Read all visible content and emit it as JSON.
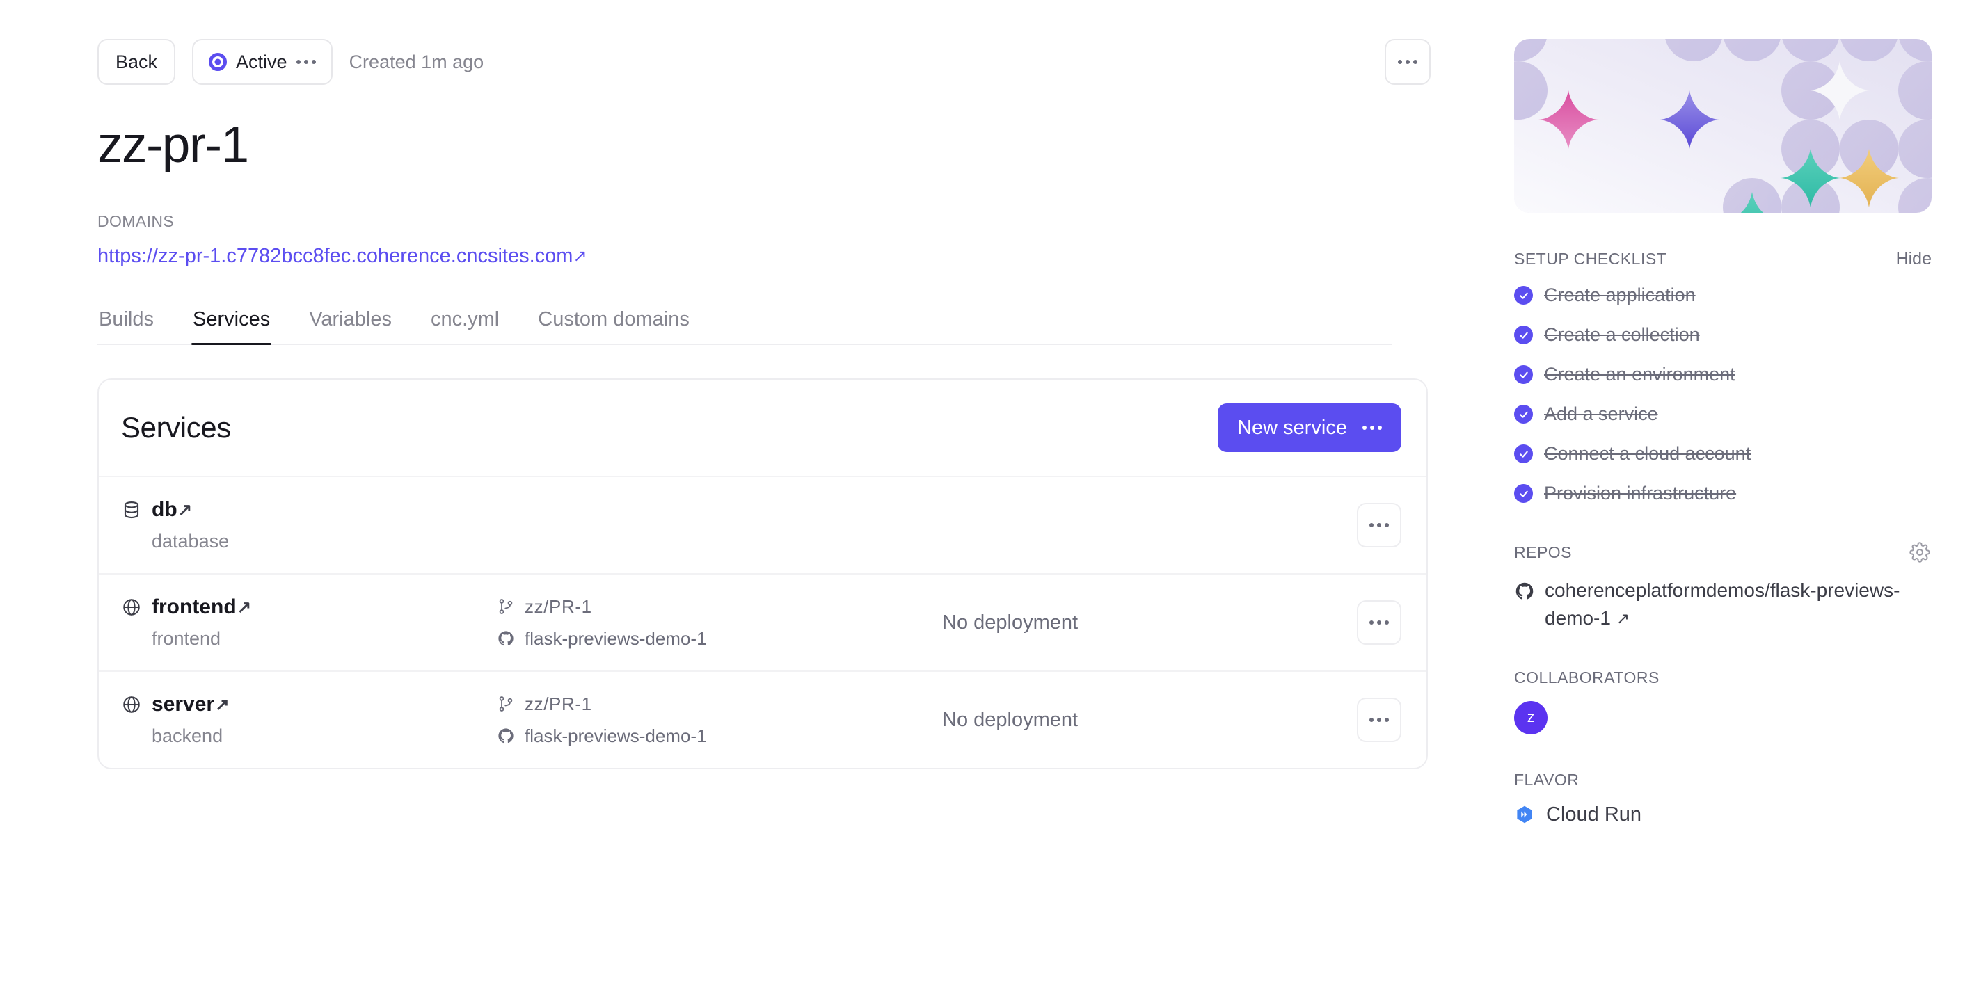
{
  "header": {
    "back_label": "Back",
    "status_label": "Active",
    "created_label": "Created 1m ago"
  },
  "title": "zz-pr-1",
  "domains": {
    "label": "DOMAINS",
    "url": "https://zz-pr-1.c7782bcc8fec.coherence.cncsites.com"
  },
  "tabs": [
    {
      "label": "Builds",
      "active": false
    },
    {
      "label": "Services",
      "active": true
    },
    {
      "label": "Variables",
      "active": false
    },
    {
      "label": "cnc.yml",
      "active": false
    },
    {
      "label": "Custom domains",
      "active": false
    }
  ],
  "services_card": {
    "title": "Services",
    "new_button_label": "New service",
    "rows": [
      {
        "icon": "database-icon",
        "name": "db",
        "subtitle": "database",
        "branch": "",
        "repo": "",
        "deployment": ""
      },
      {
        "icon": "globe-icon",
        "name": "frontend",
        "subtitle": "frontend",
        "branch": "zz/PR-1",
        "repo": "flask-previews-demo-1",
        "deployment": "No deployment"
      },
      {
        "icon": "globe-icon",
        "name": "server",
        "subtitle": "backend",
        "branch": "zz/PR-1",
        "repo": "flask-previews-demo-1",
        "deployment": "No deployment"
      }
    ]
  },
  "sidebar": {
    "checklist": {
      "title": "SETUP CHECKLIST",
      "hide_label": "Hide",
      "items": [
        {
          "label": "Create application",
          "done": true
        },
        {
          "label": "Create a collection",
          "done": true
        },
        {
          "label": "Create an environment",
          "done": true
        },
        {
          "label": "Add a service",
          "done": true
        },
        {
          "label": "Connect a cloud account",
          "done": true
        },
        {
          "label": "Provision infrastructure",
          "done": true
        }
      ]
    },
    "repos": {
      "title": "REPOS",
      "items": [
        {
          "name": "coherenceplatformdemos/flask-previews-demo-1"
        }
      ]
    },
    "collaborators": {
      "title": "COLLABORATORS",
      "items": [
        {
          "initial": "z"
        }
      ]
    },
    "flavor": {
      "title": "FLAVOR",
      "name": "Cloud Run"
    }
  },
  "colors": {
    "accent": "#5b4df0",
    "text": "#18181f",
    "muted": "#85858f",
    "border": "#ededf0",
    "pink": "#e05fa8",
    "violet": "#7a6ae0",
    "teal": "#4bc8b4",
    "amber": "#edc468",
    "lilac": "#cdc7e6"
  }
}
